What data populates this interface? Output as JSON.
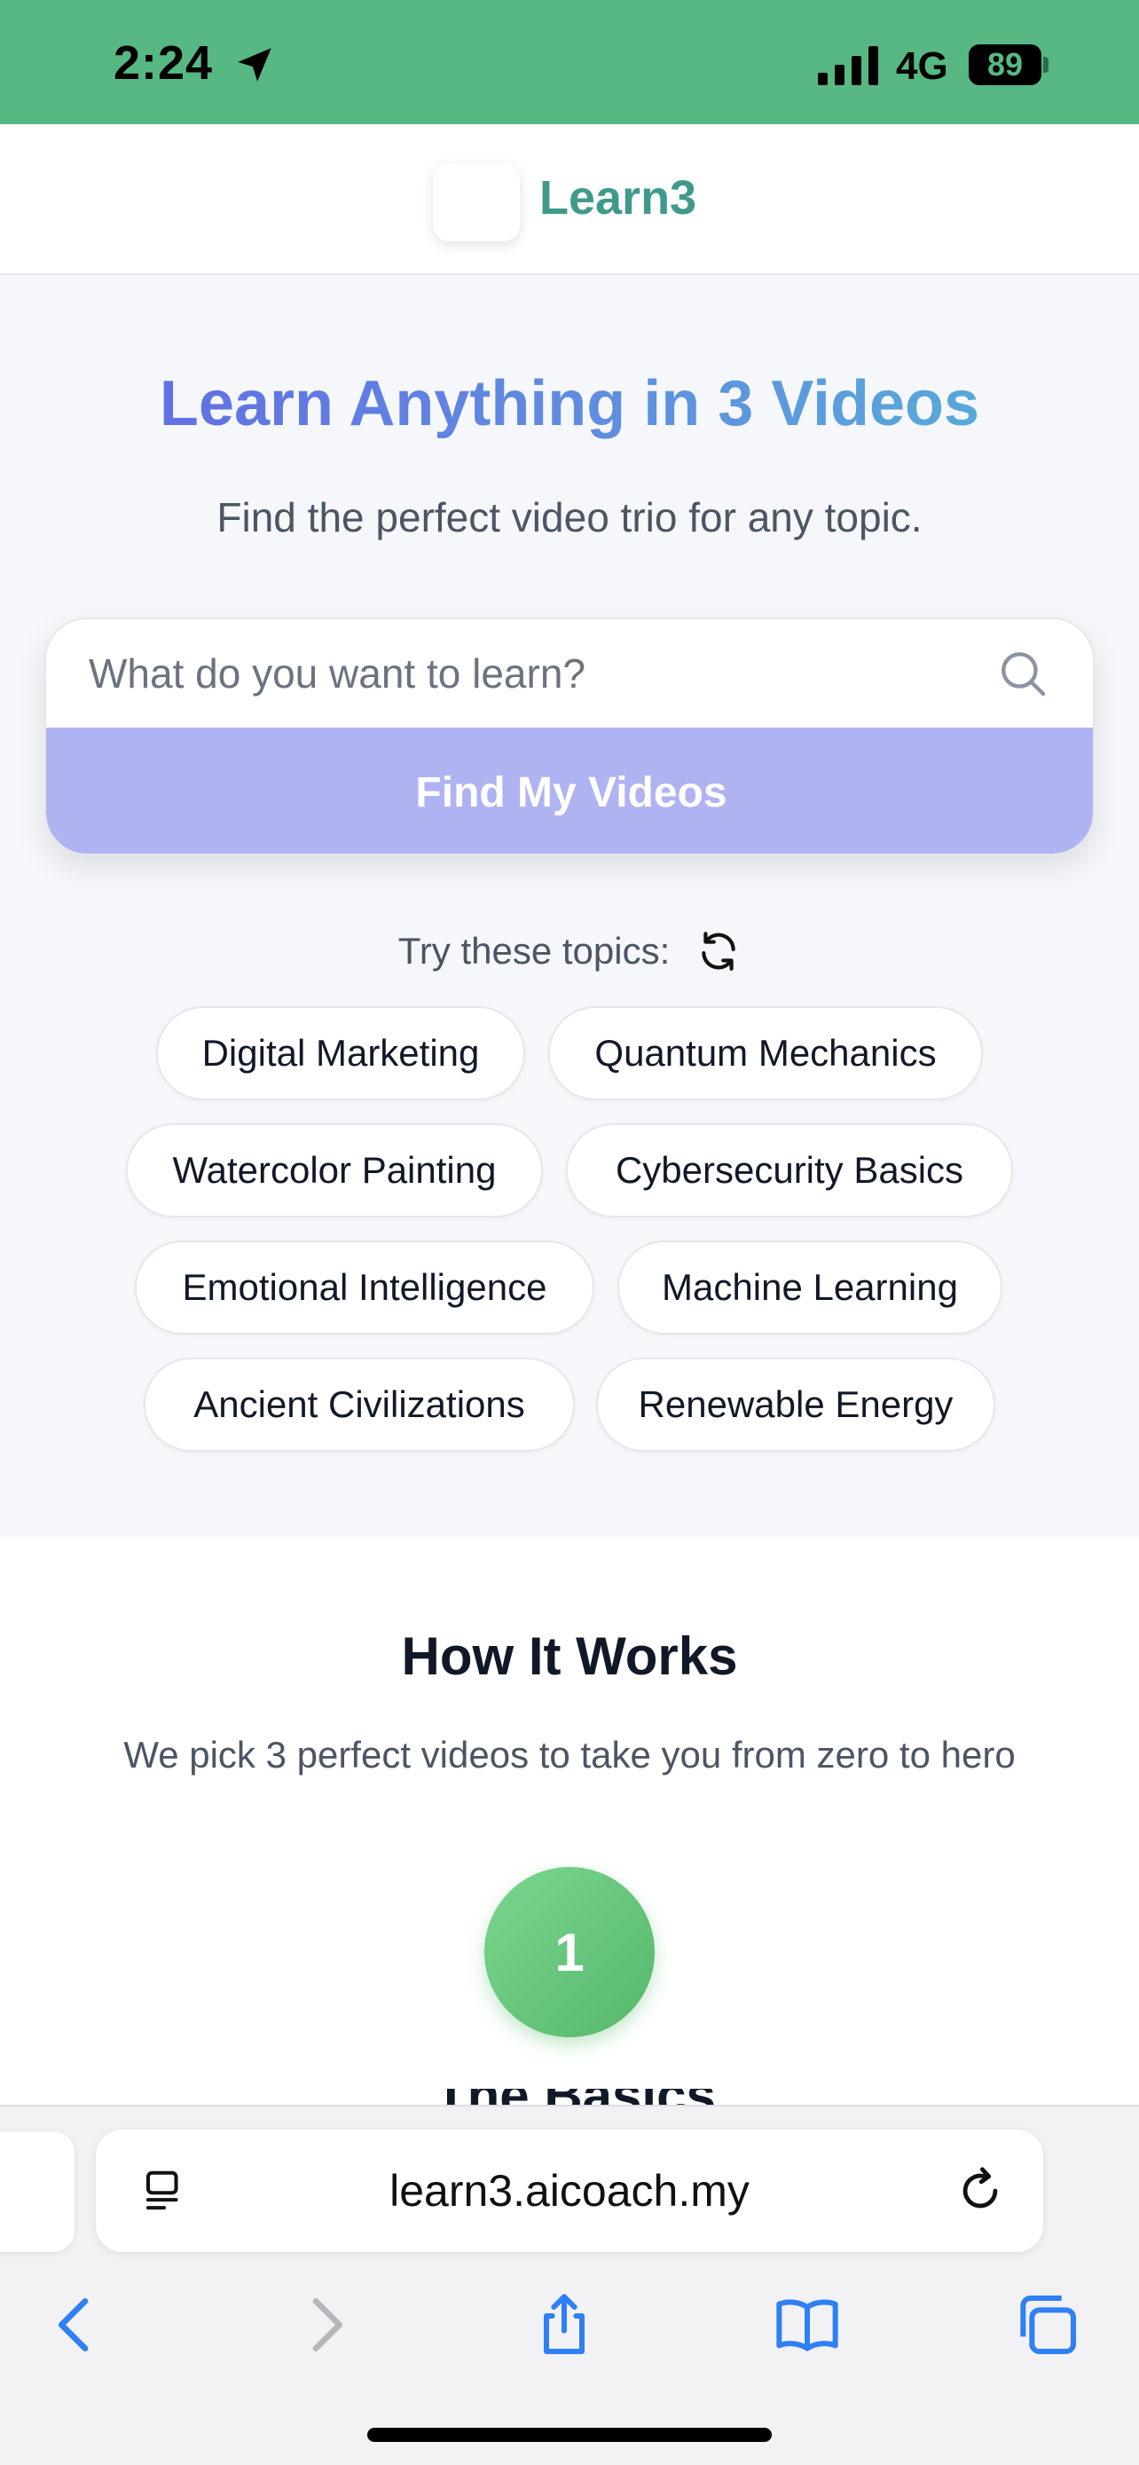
{
  "status_bar": {
    "time": "2:24",
    "network": "4G",
    "battery": "89"
  },
  "header": {
    "brand": "Learn3"
  },
  "hero": {
    "title": "Learn Anything in 3 Videos",
    "subtitle": "Find the perfect video trio for any topic.",
    "search_placeholder": "What do you want to learn?",
    "find_button": "Find My Videos",
    "try_label": "Try these topics:",
    "topics": [
      "Digital Marketing",
      "Quantum Mechanics",
      "Watercolor Painting",
      "Cybersecurity Basics",
      "Emotional Intelligence",
      "Machine Learning",
      "Ancient Civilizations",
      "Renewable Energy"
    ]
  },
  "how_it_works": {
    "title": "How It Works",
    "subtitle": "We pick 3 perfect videos to take you from zero to hero",
    "step_number": "1",
    "step_title_partial": "The Basics"
  },
  "browser": {
    "url": "learn3.aicoach.my"
  },
  "colors": {
    "status_green": "#57b883",
    "brand_teal": "#3f9a8a",
    "button_purple": "#b0b3f2",
    "step_green": "#55b86b",
    "ios_blue": "#2f7ff5"
  }
}
